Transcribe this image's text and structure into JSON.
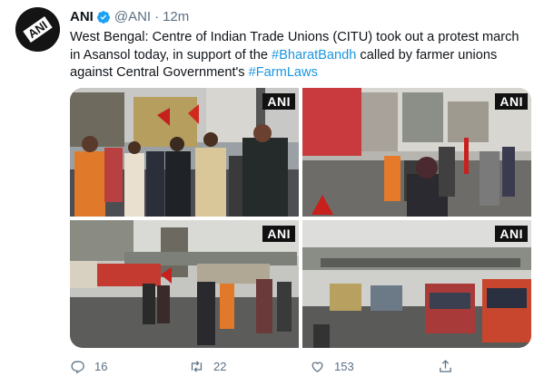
{
  "account": {
    "name": "ANI",
    "handle": "@ANI",
    "separator": "·",
    "time": "12m",
    "avatar_text": "ANI"
  },
  "tweet": {
    "text_parts": {
      "t1": "West Bengal: Centre of Indian Trade Unions (CITU) took out a protest march in Asansol today, in support of the ",
      "h1": "#BharatBandh",
      "t2": " called by farmer unions against Central Government's ",
      "h2": "#FarmLaws"
    }
  },
  "media": {
    "watermark": "ANI",
    "photos": [
      {
        "description": "Protesters standing on street with red flags"
      },
      {
        "description": "Street with protesters and shops"
      },
      {
        "description": "Bus stand with protesters"
      },
      {
        "description": "Parked buses at depot"
      }
    ]
  },
  "actions": {
    "reply_count": "16",
    "retweet_count": "22",
    "like_count": "153"
  },
  "colors": {
    "link": "#1b95e0",
    "secondary_text": "#5b7083",
    "verified": "#1da1f2"
  }
}
